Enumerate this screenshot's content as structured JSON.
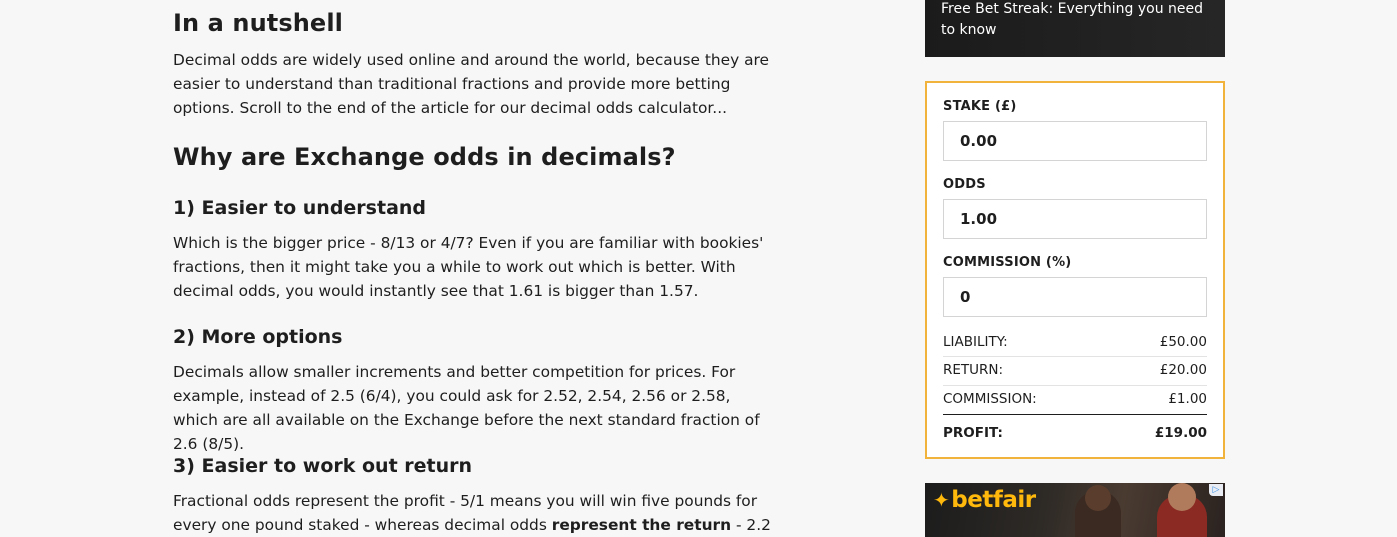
{
  "article": {
    "heading_nutshell": "In a nutshell",
    "intro": "Decimal odds are widely used online and around the world, because they are easier to understand than traditional fractions and provide more betting options. Scroll to the end of the article for our decimal odds calculator...",
    "heading_why": "Why are Exchange odds in decimals?",
    "sections": [
      {
        "title": "1) Easier to understand",
        "body": "Which is the bigger price - 8/13 or 4/7? Even if you are familiar with bookies' fractions, then it might take you a while to work out which is better. With decimal odds, you would instantly see that 1.61 is bigger than 1.57."
      },
      {
        "title": "2) More options",
        "body": "Decimals allow smaller increments and better competition for prices. For example, instead of 2.5 (6/4), you could ask for 2.52, 2.54, 2.56 or 2.58, which are all available on the Exchange before the next standard fraction of 2.6 (8/5)."
      },
      {
        "title": "3) Easier to work out return",
        "body_start": "Fractional odds represent the profit - 5/1 means you will win five pounds for every one pound staked - whereas decimal odds ",
        "body_bold": "represent the return",
        "body_end": " - 2.2"
      }
    ]
  },
  "sidebar": {
    "promo_title": "Free Bet Streak: Everything you need to know",
    "calculator": {
      "stake_label": "STAKE (£)",
      "stake_value": "0.00",
      "odds_label": "ODDS",
      "odds_value": "1.00",
      "commission_label": "COMMISSION (%)",
      "commission_value": "0",
      "liability_label": "LIABILITY:",
      "liability_value": "£50.00",
      "return_label": "RETURN:",
      "return_value": "£20.00",
      "commission_row_label": "COMMISSION:",
      "commission_row_value": "£1.00",
      "profit_label": "PROFIT:",
      "profit_value": "£19.00"
    },
    "ad": {
      "logo_text": "betfair",
      "adchoices": "▷"
    }
  },
  "colors": {
    "calculator_border": "#f2b33d",
    "betfair_yellow": "#ffb80c",
    "promo_bg": "#1b1b1b"
  }
}
